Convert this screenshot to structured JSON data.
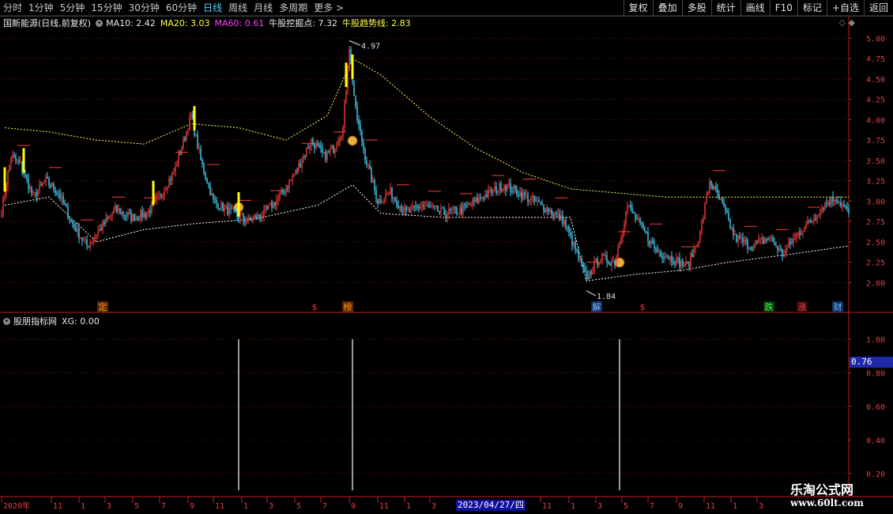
{
  "toolbar": {
    "periods": [
      "分时",
      "1分钟",
      "5分钟",
      "15分钟",
      "30分钟",
      "60分钟",
      "日线",
      "周线",
      "月线",
      "多周期",
      "更多 >"
    ],
    "active_period": "日线",
    "tools": [
      "复权",
      "叠加",
      "多股",
      "统计",
      "画线",
      "F10",
      "标记",
      "+自选",
      "返回"
    ]
  },
  "main_legend": {
    "stock": "国新能源(日线,前复权)",
    "ma10": "MA10: 2.42",
    "ma20": "MA20: 3.03",
    "ma60": "MA60: 0.61",
    "dig": "牛股挖掘点: 7.32",
    "trend": "牛股趋势线: 2.83",
    "right_marks": "◇ ◆"
  },
  "sub_legend": {
    "name": "股朋指标网",
    "xg": "XG: 0.00"
  },
  "annotations": {
    "high": "4.97",
    "low": "1.84"
  },
  "events": [
    {
      "label": "定",
      "color": "#ff8c1a",
      "bg": "#5a2a00"
    },
    {
      "label": "$",
      "color": "#ff3030",
      "bg": ""
    },
    {
      "label": "榜",
      "color": "#ff8c1a",
      "bg": "#5a2a00"
    },
    {
      "label": "解",
      "color": "#7ab8ff",
      "bg": "#103060"
    },
    {
      "label": "$",
      "color": "#ff3030",
      "bg": ""
    },
    {
      "label": "跌",
      "color": "#40ff40",
      "bg": "#0a3a0a"
    },
    {
      "label": "涨",
      "color": "#ff4040",
      "bg": "#3a0a0a"
    },
    {
      "label": "财",
      "color": "#7ab8ff",
      "bg": "#103060"
    }
  ],
  "x_axis": {
    "labels": [
      "2020年",
      "11",
      "1",
      "3",
      "5",
      "7",
      "9",
      "11",
      "1",
      "3",
      "5",
      "7",
      "9",
      "11",
      "1",
      "3",
      "11",
      "1",
      "3",
      "5",
      "7",
      "9",
      "11",
      "1",
      "3"
    ],
    "highlighted": "2023/04/27/四"
  },
  "sub_axis_highlight": "0.76",
  "watermark": {
    "line1": "乐淘公式网",
    "line2": "www.60lt.com"
  },
  "colors": {
    "up": "#ff3b3b",
    "down": "#3fd8ff",
    "trend_line": "#ffff60",
    "lower_line": "#ffffff",
    "axis": "#c02020",
    "highlight_bar": "#ffff00"
  },
  "chart_data": [
    {
      "type": "candlestick",
      "title": "国新能源(日线,前复权)",
      "ylim": [
        1.8,
        5.1
      ],
      "y_ticks": [
        2.0,
        2.25,
        2.5,
        2.75,
        3.0,
        3.25,
        3.5,
        3.75,
        4.0,
        4.25,
        4.5,
        4.75,
        5.0
      ],
      "grid": true,
      "close_anchors": [
        [
          0,
          2.9
        ],
        [
          6,
          3.55
        ],
        [
          12,
          3.45
        ],
        [
          20,
          3.05
        ],
        [
          28,
          3.25
        ],
        [
          36,
          3.1
        ],
        [
          44,
          2.75
        ],
        [
          54,
          2.45
        ],
        [
          62,
          2.65
        ],
        [
          72,
          2.9
        ],
        [
          82,
          2.8
        ],
        [
          92,
          2.85
        ],
        [
          100,
          3.05
        ],
        [
          110,
          3.4
        ],
        [
          116,
          3.8
        ],
        [
          120,
          4.05
        ],
        [
          126,
          3.5
        ],
        [
          134,
          3.0
        ],
        [
          146,
          2.85
        ],
        [
          156,
          2.75
        ],
        [
          166,
          2.85
        ],
        [
          176,
          3.05
        ],
        [
          186,
          3.35
        ],
        [
          196,
          3.75
        ],
        [
          204,
          3.55
        ],
        [
          210,
          3.65
        ],
        [
          216,
          3.9
        ],
        [
          220,
          4.9
        ],
        [
          224,
          4.1
        ],
        [
          230,
          3.55
        ],
        [
          238,
          3.0
        ],
        [
          246,
          3.1
        ],
        [
          256,
          2.85
        ],
        [
          266,
          2.95
        ],
        [
          280,
          2.85
        ],
        [
          292,
          2.9
        ],
        [
          304,
          3.05
        ],
        [
          318,
          3.2
        ],
        [
          332,
          3.05
        ],
        [
          346,
          2.9
        ],
        [
          356,
          2.75
        ],
        [
          364,
          2.35
        ],
        [
          370,
          2.05
        ],
        [
          378,
          2.3
        ],
        [
          388,
          2.25
        ],
        [
          396,
          2.95
        ],
        [
          404,
          2.7
        ],
        [
          414,
          2.4
        ],
        [
          424,
          2.3
        ],
        [
          434,
          2.2
        ],
        [
          442,
          2.6
        ],
        [
          448,
          3.25
        ],
        [
          456,
          2.95
        ],
        [
          464,
          2.55
        ],
        [
          474,
          2.45
        ],
        [
          486,
          2.55
        ],
        [
          494,
          2.35
        ],
        [
          506,
          2.65
        ],
        [
          514,
          2.8
        ],
        [
          520,
          2.95
        ],
        [
          528,
          3.05
        ],
        [
          536,
          2.85
        ]
      ],
      "high": 4.97,
      "low": 1.84,
      "series": [
        {
          "name": "牛股趋势线",
          "values": [
            [
              2,
              3.9
            ],
            [
              30,
              3.85
            ],
            [
              60,
              3.75
            ],
            [
              90,
              3.7
            ],
            [
              120,
              3.95
            ],
            [
              150,
              3.9
            ],
            [
              180,
              3.75
            ],
            [
              206,
              4.05
            ],
            [
              222,
              4.75
            ],
            [
              240,
              4.55
            ],
            [
              270,
              4.05
            ],
            [
              300,
              3.65
            ],
            [
              330,
              3.35
            ],
            [
              360,
              3.15
            ],
            [
              390,
              3.1
            ],
            [
              420,
              3.05
            ],
            [
              460,
              3.05
            ],
            [
              500,
              3.05
            ],
            [
              536,
              3.05
            ]
          ]
        },
        {
          "name": "lower",
          "values": [
            [
              2,
              2.95
            ],
            [
              30,
              3.05
            ],
            [
              60,
              2.5
            ],
            [
              90,
              2.65
            ],
            [
              120,
              2.72
            ],
            [
              160,
              2.78
            ],
            [
              200,
              2.95
            ],
            [
              222,
              3.2
            ],
            [
              240,
              2.85
            ],
            [
              280,
              2.8
            ],
            [
              320,
              2.8
            ],
            [
              360,
              2.8
            ],
            [
              370,
              2.02
            ],
            [
              400,
              2.1
            ],
            [
              430,
              2.15
            ],
            [
              460,
              2.25
            ],
            [
              500,
              2.35
            ],
            [
              536,
              2.45
            ]
          ]
        }
      ]
    },
    {
      "type": "bar",
      "title": "股朋指标网",
      "ylim": [
        0.1,
        1.08
      ],
      "y_ticks": [
        0.2,
        0.4,
        0.6,
        0.8,
        1.0
      ],
      "signals": [
        150,
        222,
        391
      ],
      "values": [
        1.0,
        1.0,
        1.0
      ]
    }
  ]
}
